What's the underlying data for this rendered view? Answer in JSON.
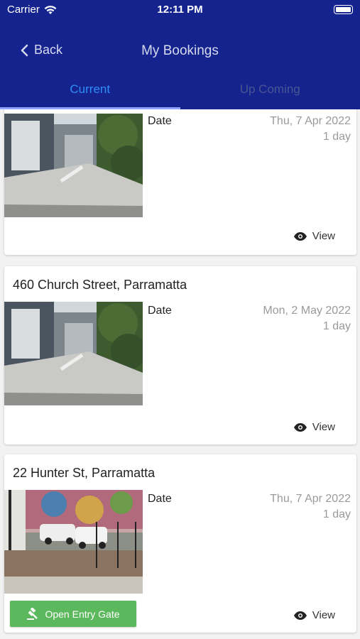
{
  "status_bar": {
    "carrier": "Carrier",
    "time": "12:11 PM"
  },
  "nav": {
    "back_label": "Back",
    "title": "My Bookings"
  },
  "tabs": [
    {
      "label": "Current",
      "active": true
    },
    {
      "label": "Up Coming",
      "active": false
    }
  ],
  "bookings": [
    {
      "address": "",
      "date_label": "Date",
      "date": "Thu, 7 Apr 2022",
      "duration": "1 day",
      "view_label": "View"
    },
    {
      "address": "460 Church Street, Parramatta",
      "date_label": "Date",
      "date": "Mon, 2 May 2022",
      "duration": "1 day",
      "view_label": "View"
    },
    {
      "address": "22 Hunter St, Parramatta",
      "date_label": "Date",
      "date": "Thu, 7 Apr 2022",
      "duration": "1 day",
      "view_label": "View",
      "gate_label": "Open Entry Gate"
    }
  ],
  "colors": {
    "header": "#15238f",
    "active_tab": "#2f8df5",
    "gate_button": "#5cb85c"
  }
}
